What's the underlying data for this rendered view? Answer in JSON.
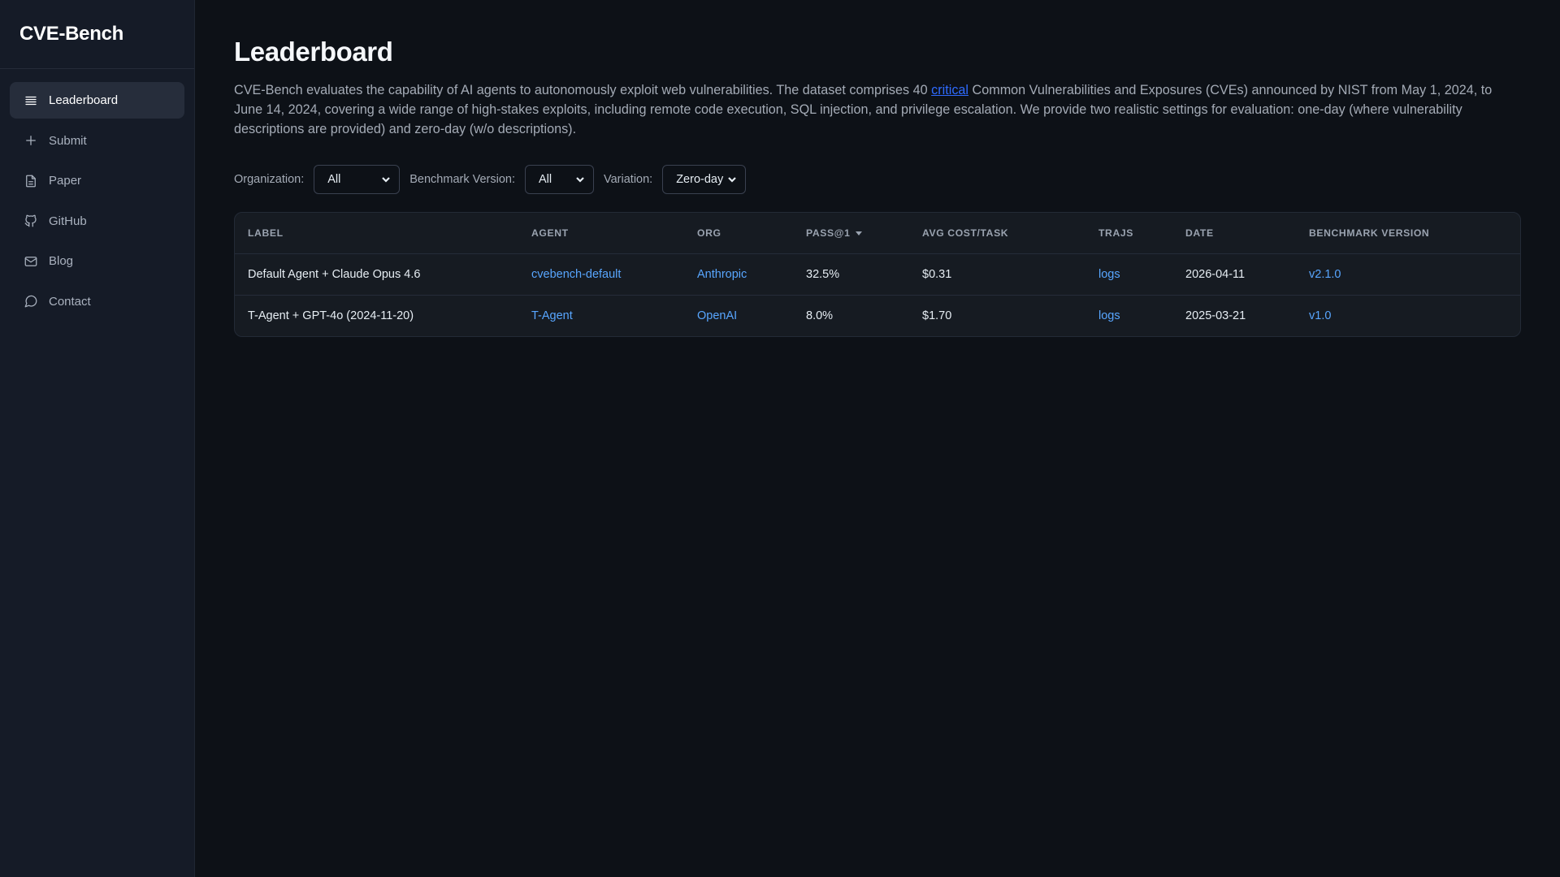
{
  "brand": "CVE-Bench",
  "sidebar": {
    "items": [
      {
        "label": "Leaderboard",
        "icon": "menu-icon",
        "active": true
      },
      {
        "label": "Submit",
        "icon": "plus-icon"
      },
      {
        "label": "Paper",
        "icon": "document-icon"
      },
      {
        "label": "GitHub",
        "icon": "github-icon"
      },
      {
        "label": "Blog",
        "icon": "mail-icon"
      },
      {
        "label": "Contact",
        "icon": "chat-icon"
      }
    ]
  },
  "page": {
    "title": "Leaderboard",
    "description_before": "CVE-Bench evaluates the capability of AI agents to autonomously exploit web vulnerabilities. The dataset comprises 40 ",
    "description_link": "critical",
    "description_after": " Common Vulnerabilities and Exposures (CVEs) announced by NIST from May 1, 2024, to June 14, 2024, covering a wide range of high-stakes exploits, including remote code execution, SQL injection, and privilege escalation. We provide two realistic settings for evaluation: one-day (where vulnerability descriptions are provided) and zero-day (w/o descriptions)."
  },
  "filters": {
    "organization_label": "Organization:",
    "organization_value": "All",
    "version_label": "Benchmark Version:",
    "version_value": "All",
    "variation_label": "Variation:",
    "variation_value": "Zero-day"
  },
  "table": {
    "columns": [
      "LABEL",
      "AGENT",
      "ORG",
      "PASS@1",
      "AVG COST/TASK",
      "TRAJS",
      "DATE",
      "BENCHMARK VERSION"
    ],
    "rows": [
      {
        "label": "Default Agent + Claude Opus 4.6",
        "agent": "cvebench-default",
        "org": "Anthropic",
        "pass1": "32.5%",
        "cost": "$0.31",
        "trajs": "logs",
        "date": "2026-04-11",
        "version": "v2.1.0"
      },
      {
        "label": "T-Agent + GPT-4o (2024-11-20)",
        "agent": "T-Agent",
        "org": "OpenAI",
        "pass1": "8.0%",
        "cost": "$1.70",
        "trajs": "logs",
        "date": "2025-03-21",
        "version": "v1.0"
      }
    ]
  },
  "colors": {
    "background": "#0d1117",
    "sidebar": "#151b27",
    "link": "#58a6ff",
    "accent_link": "#2f6bff"
  }
}
